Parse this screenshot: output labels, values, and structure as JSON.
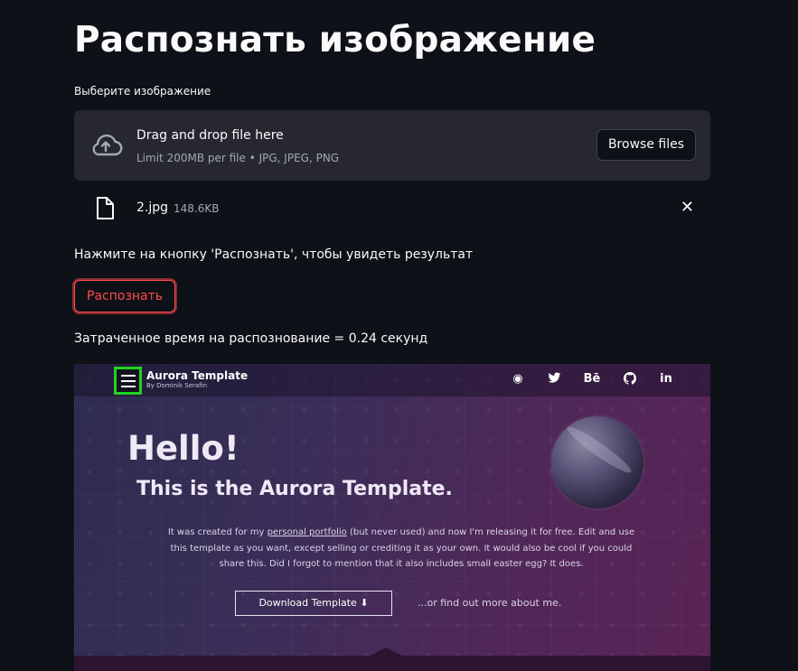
{
  "page": {
    "title": "Распознать изображение",
    "uploader_label": "Выберите изображение",
    "hint": "Нажмите на кнопку 'Распознать', чтобы увидеть результат",
    "recognize_label": "Распознать",
    "elapsed": "Затраченное время на распознование = 0.24 секунд"
  },
  "uploader": {
    "drop_title": "Drag and drop file here",
    "limit": "Limit 200MB per file • JPG, JPEG, PNG",
    "browse_label": "Browse files",
    "icon": "cloud-upload-icon"
  },
  "file": {
    "name": "2.jpg",
    "size": "148.6KB",
    "icon": "file-icon",
    "remove_icon": "close-icon"
  },
  "preview": {
    "brand_name": "Aurora Template",
    "brand_sub": "By Dominik Serafin",
    "social": [
      "◉",
      "🐦",
      "Bē",
      "◎",
      "in"
    ],
    "hello": "Hello!",
    "subtitle": "This is the Aurora Template.",
    "desc_before": "It was created for my ",
    "desc_link": "personal portfolio",
    "desc_after": " (but never used) and now I'm releasing it for free. Edit and use this template as you want, except selling or crediting it as your own. It would also be cool if you could share this. Did I forgot to mention that it also includes small easter egg? It does.",
    "download": "Download Template ⬇",
    "find_more": "...or find out more about me.",
    "highlight_color": "#22d322"
  },
  "colors": {
    "background": "#0e1117",
    "accent": "#ff4b4b",
    "uploader_bg": "#262730"
  }
}
